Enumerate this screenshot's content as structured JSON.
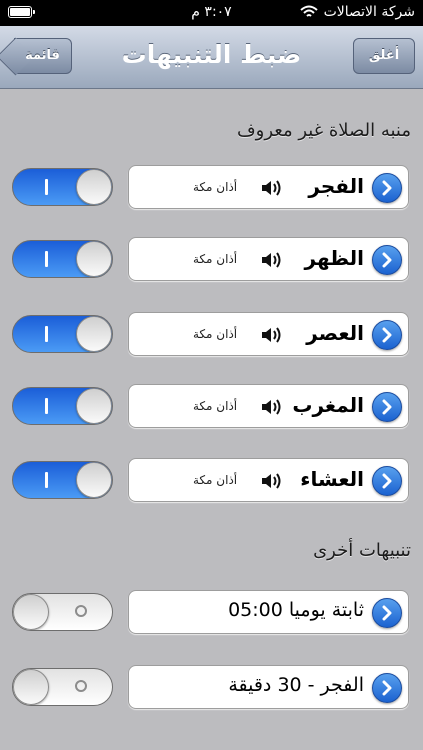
{
  "status_bar": {
    "carrier": "شركة الاتصالات",
    "time": "٣:٠٧ م"
  },
  "nav": {
    "title": "ضبط التنبيهات",
    "close_label": "أغلق",
    "list_label": "قائمة"
  },
  "sections": {
    "prayers_header": "منبه الصلاة غير معروف",
    "other_header": "تنبيهات أخرى"
  },
  "prayers": [
    {
      "name": "الفجر",
      "sound": "أذان مكة",
      "enabled": true
    },
    {
      "name": "الظهر",
      "sound": "أذان مكة",
      "enabled": true
    },
    {
      "name": "العصر",
      "sound": "أذان مكة",
      "enabled": true
    },
    {
      "name": "المغرب",
      "sound": "أذان مكة",
      "enabled": true
    },
    {
      "name": "العشاء",
      "sound": "أذان مكة",
      "enabled": true
    }
  ],
  "other_alerts": [
    {
      "label": "ثابتة يوميا 05:00",
      "enabled": false
    },
    {
      "label": "الفجر - 30 دقيقة",
      "enabled": false
    }
  ],
  "colors": {
    "toggle_on": "#1b5ed8",
    "disclosure": "#1b62d0",
    "background": "#bcbcbf"
  },
  "icons": {
    "disclosure": "chevron-right-icon",
    "speaker": "speaker-icon",
    "wifi": "wifi-icon",
    "battery": "battery-icon"
  }
}
